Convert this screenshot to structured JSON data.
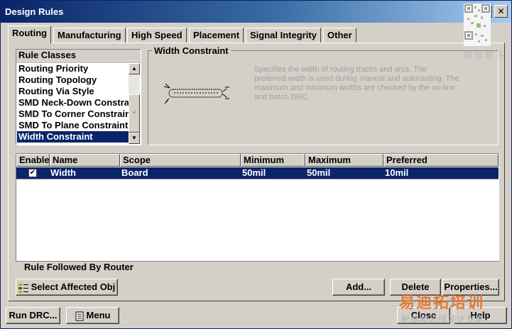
{
  "window": {
    "title": "Design Rules"
  },
  "titlebar_buttons": {
    "help": "?",
    "close": "✕"
  },
  "tabs": [
    {
      "label": "Routing",
      "active": true
    },
    {
      "label": "Manufacturing",
      "active": false
    },
    {
      "label": "High Speed",
      "active": false
    },
    {
      "label": "Placement",
      "active": false
    },
    {
      "label": "Signal Integrity",
      "active": false
    },
    {
      "label": "Other",
      "active": false
    }
  ],
  "rule_classes": {
    "header": "Rule Classes",
    "items": [
      {
        "label": "Routing Priority",
        "selected": false
      },
      {
        "label": "Routing Topology",
        "selected": false
      },
      {
        "label": "Routing Via Style",
        "selected": false
      },
      {
        "label": "SMD Neck-Down Constraint",
        "selected": false
      },
      {
        "label": "SMD To Corner Constraint",
        "selected": false
      },
      {
        "label": "SMD To Plane Constraint",
        "selected": false
      },
      {
        "label": "Width Constraint",
        "selected": true
      }
    ]
  },
  "constraint_group": {
    "label": "Width Constraint",
    "description": "Specifies the width of routing tracks and arcs. The preferred width is used during manual and autorouting. The maximum and minimum widths are checked by the on-line and batch DRC."
  },
  "grid": {
    "columns": [
      "Enable",
      "Name",
      "Scope",
      "Minimum",
      "Maximum",
      "Preferred"
    ],
    "rows": [
      {
        "enabled": true,
        "name": "Width",
        "scope": "Board",
        "minimum": "50mil",
        "maximum": "50mil",
        "preferred": "10mil"
      }
    ],
    "footer": "Rule Followed By Router"
  },
  "buttons": {
    "select_affected": "Select Affected Obj",
    "add": "Add...",
    "delete": "Delete",
    "properties": "Properties...",
    "run_drc": "Run DRC...",
    "menu": "Menu",
    "close": "Close",
    "help": "Help"
  },
  "watermarks": {
    "qr_caption": "微信联系",
    "brand": "易迪拓培训",
    "brand_sub": "射频和天线设计专家"
  },
  "colors": {
    "title_start": "#0a246a",
    "title_end": "#a6caf0",
    "selection": "#0a246a",
    "face": "#d4d0c8",
    "brand_orange": "#e56a1f"
  }
}
